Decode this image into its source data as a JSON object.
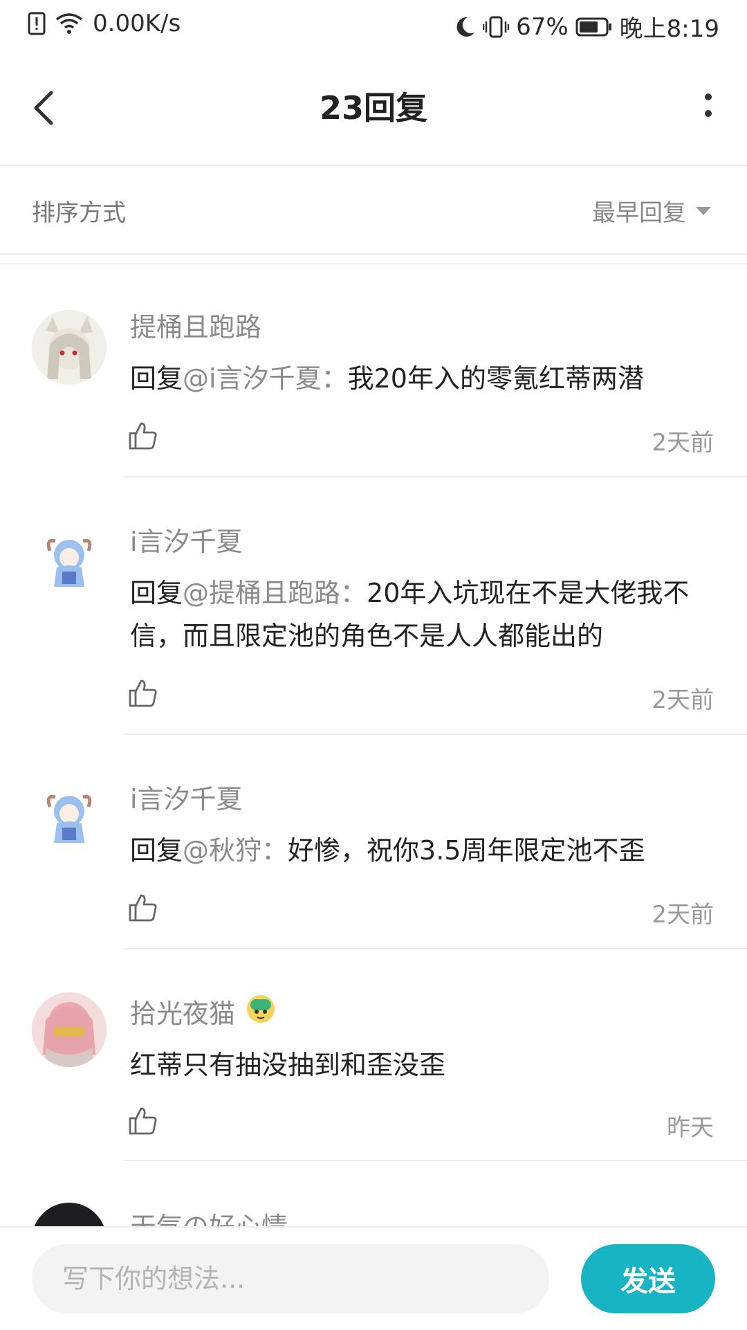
{
  "status_bar": {
    "net_speed": "0.00K/s",
    "battery": "67%",
    "time": "晚上8:19",
    "icons": [
      "alert-icon",
      "wifi-icon",
      "moon-icon",
      "vibrate-icon",
      "battery-icon"
    ]
  },
  "nav": {
    "title": "23回复",
    "icons": [
      "back-icon",
      "more-icon"
    ]
  },
  "sort": {
    "label": "排序方式",
    "value": "最早回复"
  },
  "comments": [
    {
      "author": "提桶且跑路",
      "text_prefix": "回复",
      "mention": "@i言汐千夏",
      "colon": "：",
      "text": "我20年入的零氪红蒂两潜",
      "time": "2天前"
    },
    {
      "author": "i言汐千夏",
      "text_prefix": "回复",
      "mention": "@提桶且跑路",
      "colon": "：",
      "text": "20年入坑现在不是大佬我不信，而且限定池的角色不是人人都能出的",
      "time": "2天前"
    },
    {
      "author": "i言汐千夏",
      "text_prefix": "回复",
      "mention": "@秋狩",
      "colon": "：",
      "text": "好惨，祝你3.5周年限定池不歪",
      "time": "2天前"
    },
    {
      "author": "拾光夜猫",
      "text_prefix": "",
      "mention": "",
      "colon": "",
      "text": "红蒂只有抽没抽到和歪没歪",
      "time": "昨天"
    }
  ],
  "partial_comment": {
    "author": "天气の好心情"
  },
  "input": {
    "placeholder": "写下你的想法..."
  },
  "send_label": "发送",
  "colors": {
    "accent": "#19b4c4",
    "mention": "#8a8a8a",
    "divider": "#ececec"
  }
}
